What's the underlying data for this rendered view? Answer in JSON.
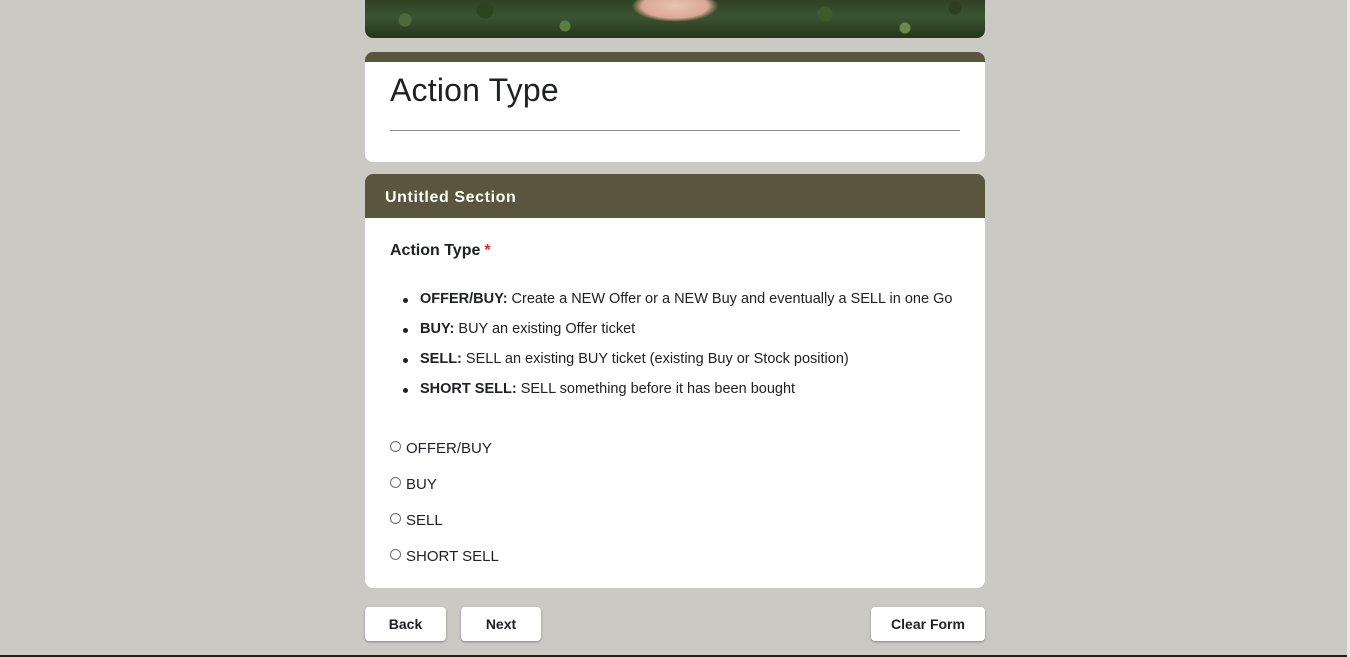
{
  "header": {
    "form_title": "Action Type"
  },
  "section": {
    "title": "Untitled Section",
    "question": {
      "title": "Action Type",
      "required_marker": "*",
      "description": [
        {
          "term": "OFFER/BUY:",
          "text": " Create a NEW Offer or a NEW Buy and eventually a SELL in one Go"
        },
        {
          "term": "BUY:",
          "text": " BUY an existing Offer ticket"
        },
        {
          "term": "SELL:",
          "text": " SELL an existing BUY ticket (existing Buy or Stock position)"
        },
        {
          "term": "SHORT SELL:",
          "text": " SELL something before it has been bought"
        }
      ],
      "options": [
        "OFFER/BUY",
        "BUY",
        "SELL",
        "SHORT SELL"
      ]
    }
  },
  "nav": {
    "back_label": "Back",
    "next_label": "Next",
    "clear_label": "Clear Form"
  },
  "colors": {
    "background": "#cbc9c3",
    "accent": "#5a563d",
    "required": "#d93025"
  }
}
